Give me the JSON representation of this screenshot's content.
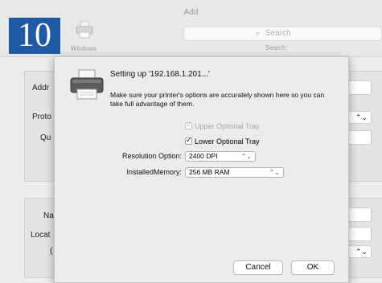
{
  "badge": "10",
  "window": {
    "title": "Add",
    "toolbar": {
      "windows_label": "Windows",
      "windows_icon": "printer-icon",
      "search_placeholder": "Search",
      "search_label": "Search",
      "search_icon": "search-icon"
    },
    "form_labels": {
      "address": "Addr",
      "protocol": "Proto",
      "queue": "Qu",
      "name": "Na",
      "location": "Locat",
      "use": "("
    },
    "popup_arrow": "⌃⌄"
  },
  "sheet": {
    "title": "Setting up '192.168.1.201...'",
    "description": "Make sure your printer's options are accurately shown here so you can take full advantage of them.",
    "options": {
      "upper_tray": {
        "label": "Upper Optional Tray",
        "checked": true,
        "enabled": false
      },
      "lower_tray": {
        "label": "Lower Optional Tray",
        "checked": true,
        "enabled": true
      }
    },
    "resolution": {
      "label": "Resolution Option:",
      "value": "2400 DPI"
    },
    "memory": {
      "label": "InstalledMemory:",
      "value": "256 MB RAM"
    },
    "buttons": {
      "cancel": "Cancel",
      "ok": "OK"
    }
  }
}
